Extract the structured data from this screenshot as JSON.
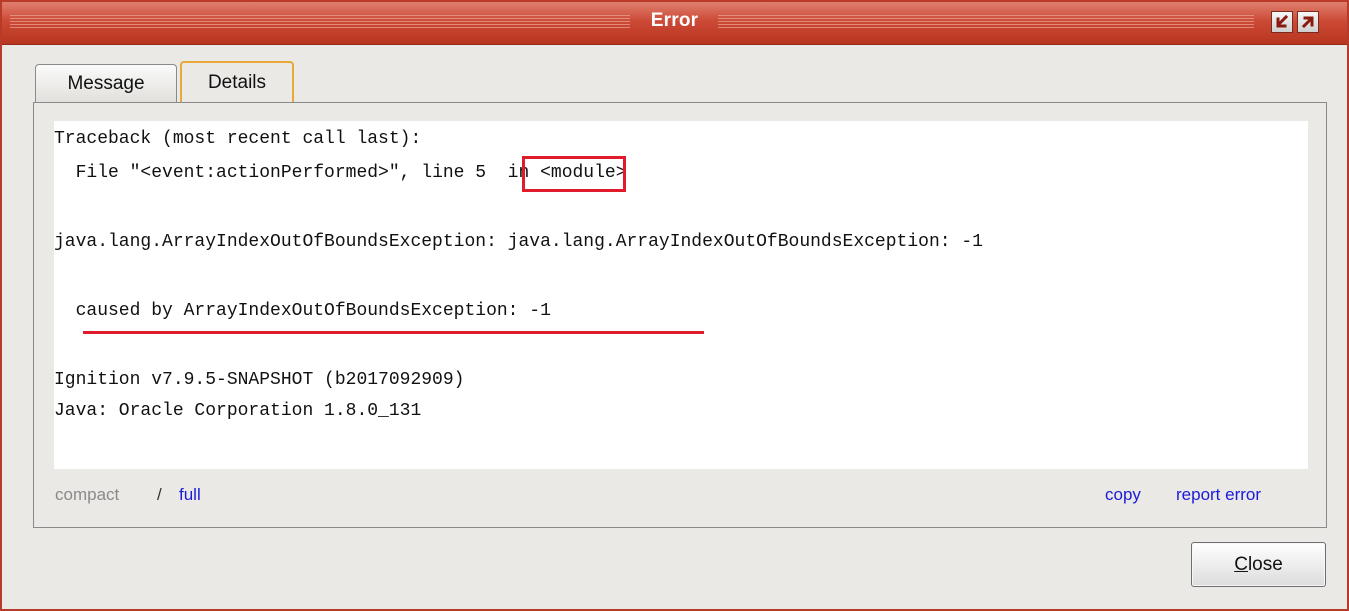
{
  "window": {
    "title": "Error",
    "controls": [
      "minimize-restore-icon",
      "maximize-icon"
    ]
  },
  "tabs": [
    {
      "label": "Message",
      "active": false
    },
    {
      "label": "Details",
      "active": true
    }
  ],
  "details": {
    "line1": "Traceback (most recent call last):",
    "line2_prefix": "  File \"<event:actionPerformed>\", ",
    "line2_highlight": "line 5",
    "line2_suffix": "  in <module>",
    "line3": "java.lang.ArrayIndexOutOfBoundsException: java.lang.ArrayIndexOutOfBoundsException: -1",
    "line4": "  caused by ArrayIndexOutOfBoundsException: -1",
    "line5": "Ignition v7.9.5-SNAPSHOT (b2017092909)",
    "line6": "Java: Oracle Corporation 1.8.0_131"
  },
  "view_modes": {
    "compact": "compact",
    "separator": "/",
    "full": "full"
  },
  "actions": {
    "copy": "copy",
    "report": "report error"
  },
  "close_button": {
    "mnemonic": "C",
    "rest": "lose"
  },
  "colors": {
    "titlebar": "#cc4a36",
    "highlight": "#e01b2b",
    "link": "#1b1bd8",
    "active_tab_border": "#e6a93a"
  }
}
